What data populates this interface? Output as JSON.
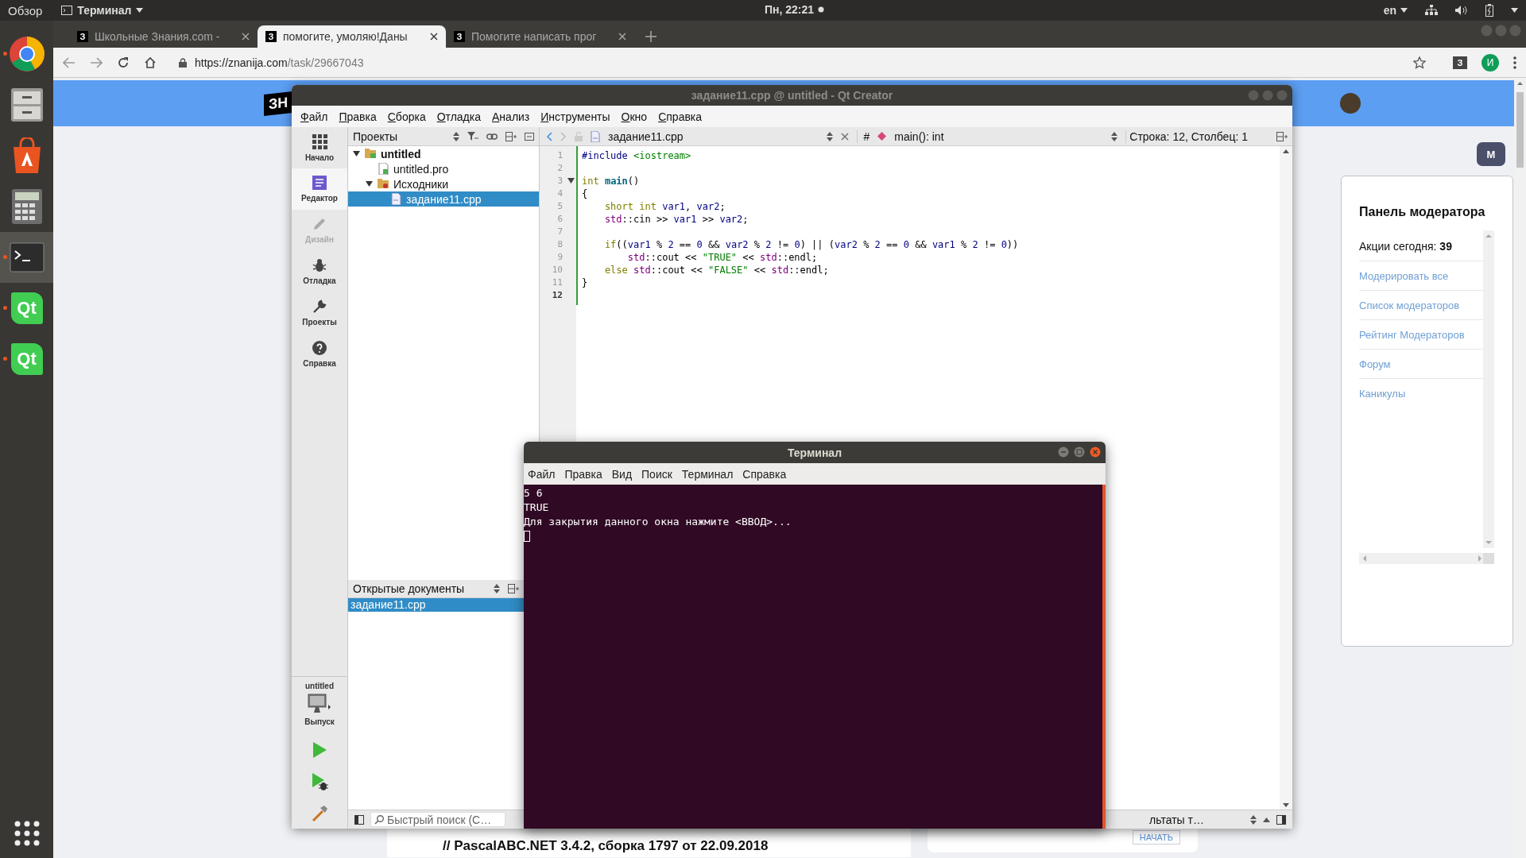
{
  "top_bar": {
    "activities": "Обзор",
    "app_menu": "Терминал",
    "clock": "Пн, 22:21",
    "language": "en"
  },
  "dock": [
    {
      "kind": "chrome",
      "running": true,
      "selected": false
    },
    {
      "kind": "files",
      "running": false,
      "selected": false
    },
    {
      "kind": "store",
      "running": false,
      "selected": false
    },
    {
      "kind": "calculator",
      "running": false,
      "selected": false
    },
    {
      "kind": "terminal",
      "running": true,
      "selected": true
    },
    {
      "kind": "qt",
      "label": "Qt",
      "running": true,
      "selected": false
    },
    {
      "kind": "qt",
      "label": "Qt",
      "running": true,
      "selected": false
    }
  ],
  "browser": {
    "tabs": [
      {
        "favicon": "З",
        "title": "Школьные Знания.com -",
        "selected": false
      },
      {
        "favicon": "З",
        "title": "помогите, умоляю!Даны",
        "selected": true
      },
      {
        "favicon": "З",
        "title": "Помогите написать прог",
        "selected": false
      }
    ],
    "url_host": "https://znanija.com",
    "url_path": "/task/29667043",
    "extension": "З",
    "profile": "И"
  },
  "page": {
    "logo": "ЗН",
    "moderator_button": "M",
    "panel": {
      "title": "Панель модератора",
      "actions": "Акции сегодня: **39**",
      "links": [
        "Модерировать все",
        "Список модераторов",
        "Рейтинг Модераторов",
        "Форум",
        "Каникулы"
      ]
    },
    "question_text": "// PascalABC.NET 3.4.2, сборка 1797 от 22.09.2018",
    "start_button": "НАЧАТЬ"
  },
  "qt": {
    "title": "задание11.cpp @ untitled - Qt Creator",
    "menu": [
      "Файл",
      "Правка",
      "Сборка",
      "Отладка",
      "Анализ",
      "Инструменты",
      "Окно",
      "Справка"
    ],
    "modes": [
      {
        "label": "Начало",
        "selected": false,
        "disabled": false
      },
      {
        "label": "Редактор",
        "selected": true,
        "disabled": false
      },
      {
        "label": "Дизайн",
        "selected": false,
        "disabled": true
      },
      {
        "label": "Отладка",
        "selected": false,
        "disabled": false
      },
      {
        "label": "Проекты",
        "selected": false,
        "disabled": false
      },
      {
        "label": "Справка",
        "selected": false,
        "disabled": false
      }
    ],
    "kit": "untitled",
    "kit_mode": "Выпуск",
    "projects_label": "Проекты",
    "tree": [
      {
        "label": "untitled",
        "kind": "project",
        "expanded": true,
        "selected": false,
        "children": [
          {
            "label": "untitled.pro",
            "kind": "pro",
            "selected": false
          },
          {
            "label": "Исходники",
            "kind": "folder",
            "expanded": true,
            "selected": false,
            "children": [
              {
                "label": "задание11.cpp",
                "kind": "cpp",
                "selected": true
              }
            ]
          }
        ]
      }
    ],
    "open_docs_label": "Открытые документы",
    "open_docs": [
      {
        "name": "задание11.cpp",
        "selected": true
      }
    ],
    "file_tab": "задание11.cpp",
    "hash": "#",
    "symbol": "main(): int",
    "position": "Строка: 12, Столбец: 1",
    "code": [
      {
        "number": "1",
        "current": false,
        "tokens": [
          {
            "kind": "pre",
            "text": "#include "
          },
          {
            "kind": "str",
            "text": "<iostream>"
          }
        ]
      },
      {
        "number": "2",
        "current": false
      },
      {
        "number": "3",
        "current": false,
        "fold": true,
        "tokens": [
          {
            "kind": "kw",
            "text": "int "
          },
          {
            "kind": "fn",
            "text": "main"
          },
          {
            "kind": "plain",
            "text": "()"
          }
        ]
      },
      {
        "number": "4",
        "current": false,
        "tokens": [
          {
            "kind": "plain",
            "text": "{"
          }
        ]
      },
      {
        "number": "5",
        "current": false,
        "tokens": [
          {
            "kind": "kw",
            "text": "    short int "
          },
          {
            "kind": "var",
            "text": "var1"
          },
          {
            "kind": "plain",
            "text": ", "
          },
          {
            "kind": "var",
            "text": "var2"
          },
          {
            "kind": "plain",
            "text": ";"
          }
        ]
      },
      {
        "number": "6",
        "current": false,
        "tokens": [
          {
            "kind": "ns",
            "text": "    std"
          },
          {
            "kind": "plain",
            "text": "::cin >> "
          },
          {
            "kind": "var",
            "text": "var1"
          },
          {
            "kind": "plain",
            "text": " >> "
          },
          {
            "kind": "var",
            "text": "var2"
          },
          {
            "kind": "plain",
            "text": ";"
          }
        ]
      },
      {
        "number": "7",
        "current": false
      },
      {
        "number": "8",
        "current": false,
        "tokens": [
          {
            "kind": "kw",
            "text": "    if"
          },
          {
            "kind": "plain",
            "text": "(("
          },
          {
            "kind": "var",
            "text": "var1"
          },
          {
            "kind": "plain",
            "text": " % "
          },
          {
            "kind": "num",
            "text": "2"
          },
          {
            "kind": "plain",
            "text": " == "
          },
          {
            "kind": "num",
            "text": "0"
          },
          {
            "kind": "plain",
            "text": " && "
          },
          {
            "kind": "var",
            "text": "var2"
          },
          {
            "kind": "plain",
            "text": " % "
          },
          {
            "kind": "num",
            "text": "2"
          },
          {
            "kind": "plain",
            "text": " != "
          },
          {
            "kind": "num",
            "text": "0"
          },
          {
            "kind": "plain",
            "text": ") || ("
          },
          {
            "kind": "var",
            "text": "var2"
          },
          {
            "kind": "plain",
            "text": " % "
          },
          {
            "kind": "num",
            "text": "2"
          },
          {
            "kind": "plain",
            "text": " == "
          },
          {
            "kind": "num",
            "text": "0"
          },
          {
            "kind": "plain",
            "text": " && "
          },
          {
            "kind": "var",
            "text": "var1"
          },
          {
            "kind": "plain",
            "text": " % "
          },
          {
            "kind": "num",
            "text": "2"
          },
          {
            "kind": "plain",
            "text": " != "
          },
          {
            "kind": "num",
            "text": "0"
          },
          {
            "kind": "plain",
            "text": "))"
          }
        ]
      },
      {
        "number": "9",
        "current": false,
        "tokens": [
          {
            "kind": "ns",
            "text": "        std"
          },
          {
            "kind": "plain",
            "text": "::cout << "
          },
          {
            "kind": "str",
            "text": "\"TRUE\""
          },
          {
            "kind": "plain",
            "text": " << "
          },
          {
            "kind": "ns",
            "text": "std"
          },
          {
            "kind": "plain",
            "text": "::endl;"
          }
        ]
      },
      {
        "number": "10",
        "current": false,
        "tokens": [
          {
            "kind": "kw",
            "text": "    else "
          },
          {
            "kind": "ns",
            "text": "std"
          },
          {
            "kind": "plain",
            "text": "::cout << "
          },
          {
            "kind": "str",
            "text": "\"FALSE\""
          },
          {
            "kind": "plain",
            "text": " << "
          },
          {
            "kind": "ns",
            "text": "std"
          },
          {
            "kind": "plain",
            "text": "::endl;"
          }
        ]
      },
      {
        "number": "11",
        "current": false,
        "tokens": [
          {
            "kind": "plain",
            "text": "}"
          }
        ]
      },
      {
        "number": "12",
        "current": true
      }
    ],
    "search_placeholder": "Быстрый поиск (C…",
    "output_label": "льтаты т…"
  },
  "terminal": {
    "title": "Терминал",
    "menu": [
      "Файл",
      "Правка",
      "Вид",
      "Поиск",
      "Терминал",
      "Справка"
    ],
    "lines": [
      "5 6",
      "TRUE",
      "Для закрытия данного окна нажмите <ВВОД>..."
    ]
  }
}
